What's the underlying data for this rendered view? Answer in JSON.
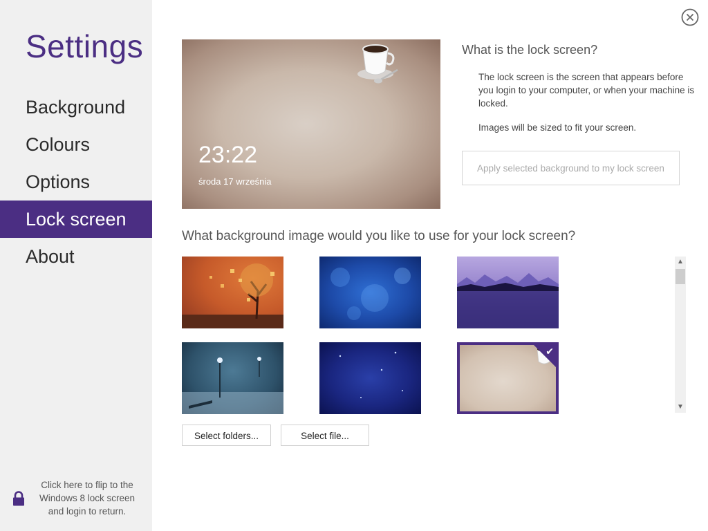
{
  "sidebar": {
    "title": "Settings",
    "items": [
      {
        "label": "Background"
      },
      {
        "label": "Colours"
      },
      {
        "label": "Options"
      },
      {
        "label": "Lock screen",
        "active": true
      },
      {
        "label": "About"
      }
    ],
    "footer_text": "Click here to flip to the Windows 8 lock screen and login to return."
  },
  "preview": {
    "time": "23:22",
    "date": "środa 17 września"
  },
  "info": {
    "heading": "What is the lock screen?",
    "p1": "The lock screen is the screen that appears before you login to your computer, or when your machine is locked.",
    "p2": "Images will be sized to fit your screen.",
    "apply_label": "Apply selected background to my lock screen"
  },
  "gallery": {
    "question": "What background image would you like to use for your lock screen?",
    "selected_index": 5,
    "select_folders_label": "Select folders...",
    "select_file_label": "Select file..."
  },
  "colors": {
    "accent": "#4b2e83",
    "sidebar_bg": "#f0f0f0"
  }
}
